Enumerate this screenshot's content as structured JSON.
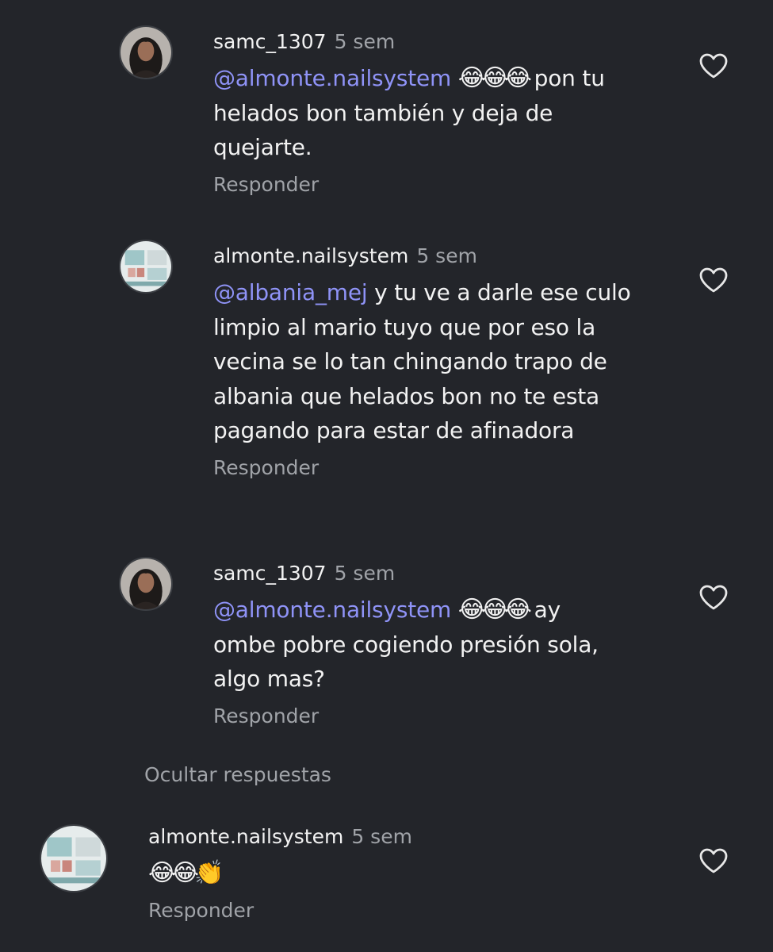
{
  "comments": [
    {
      "username": "samc_1307",
      "time": "5 sem",
      "mention": "@almonte.nailsystem",
      "emojis": "😂😂😂",
      "text": " pon tu helados bon también y deja de quejarte.",
      "reply_label": "Responder",
      "avatar": "woman-selfie-avatar"
    },
    {
      "username": "almonte.nailsystem",
      "time": "5 sem",
      "mention": "@albania_mej",
      "emojis": "",
      "text": " y tu ve a darle ese culo limpio al mario tuyo que por eso la vecina se lo tan chingando trapo de albania que helados bon no te esta pagando para estar de afinadora",
      "reply_label": "Responder",
      "avatar": "nail-salon-logo-avatar"
    },
    {
      "username": "samc_1307",
      "time": "5 sem",
      "mention": "@almonte.nailsystem",
      "emojis": "😂😂😂",
      "text": " ay ombe pobre cogiendo presión sola, algo mas?",
      "reply_label": "Responder",
      "avatar": "woman-selfie-avatar"
    },
    {
      "username": "almonte.nailsystem",
      "time": "5 sem",
      "mention": "",
      "emojis": "😂😂👏",
      "text": "",
      "reply_label": "Responder",
      "avatar": "nail-salon-logo-avatar"
    }
  ],
  "hide_replies_label": "Ocultar respuestas",
  "colors": {
    "background": "#23252a",
    "mention": "#8f93f7",
    "secondary_text": "#a0a3a8"
  }
}
